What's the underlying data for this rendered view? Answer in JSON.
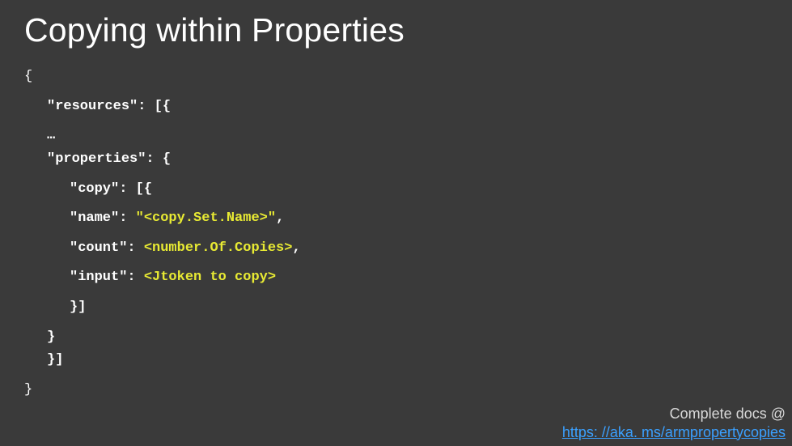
{
  "title": "Copying within Properties",
  "code": {
    "l1": "{",
    "l2_key": "\"resources\"",
    "l2_rest": ": [{",
    "l3": "…",
    "l4_key": "\"properties\"",
    "l4_rest": ": {",
    "l5_key": "\"copy\"",
    "l5_rest": ": [{",
    "l6_key": "\"name\"",
    "l6_mid": ": ",
    "l6_val": "\"<copy.Set.Name>\"",
    "l6_end": ",",
    "l7_key": "\"count\"",
    "l7_mid": ": ",
    "l7_val": "<number.Of.Copies>",
    "l7_end": ",",
    "l8_key": "\"input\"",
    "l8_mid": ": ",
    "l8_val": "<Jtoken to copy>",
    "l9": "}]",
    "l10": "}",
    "l11": "}]",
    "l12": "}"
  },
  "footer": {
    "text": "Complete docs @",
    "link_text": "https: //aka. ms/armpropertycopies",
    "link_href": "https://aka.ms/armpropertycopies"
  }
}
